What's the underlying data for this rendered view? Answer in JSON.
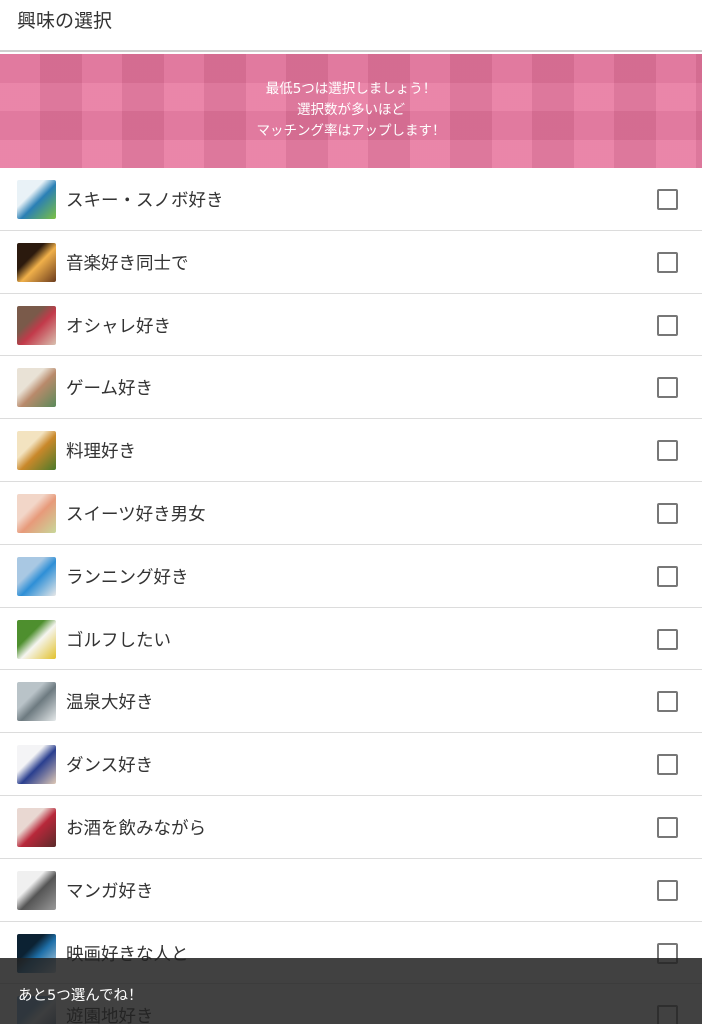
{
  "header": {
    "title": "興味の選択"
  },
  "banner": {
    "line1": "最低5つは選択しましょう！",
    "line2": "選択数が多いほど",
    "line3": "マッチング率はアップします！"
  },
  "interests": [
    {
      "label": "スキー・スノボ好き",
      "icon": "ski-photo-icon",
      "checked": false,
      "colors": [
        "#e9f2f7",
        "#2a7fb5",
        "#7cc142"
      ]
    },
    {
      "label": "音楽好き同士で",
      "icon": "concert-photo-icon",
      "checked": false,
      "colors": [
        "#2b1a0e",
        "#f0b04a",
        "#6b3b1c"
      ]
    },
    {
      "label": "オシャレ好き",
      "icon": "fashion-bag-photo-icon",
      "checked": false,
      "colors": [
        "#7a5a4a",
        "#c23a4a",
        "#d9c1b0"
      ]
    },
    {
      "label": "ゲーム好き",
      "icon": "game-device-photo-icon",
      "checked": false,
      "colors": [
        "#e9e2d6",
        "#b98a6b",
        "#5a8a5a"
      ]
    },
    {
      "label": "料理好き",
      "icon": "cooking-photo-icon",
      "checked": false,
      "colors": [
        "#f3e3c0",
        "#c9882a",
        "#4a7a2a"
      ]
    },
    {
      "label": "スイーツ好き男女",
      "icon": "macaron-photo-icon",
      "checked": false,
      "colors": [
        "#f2d6c8",
        "#e79a7a",
        "#c8d89a"
      ]
    },
    {
      "label": "ランニング好き",
      "icon": "running-photo-icon",
      "checked": false,
      "colors": [
        "#a9c8e3",
        "#2e8fd6",
        "#e8e8e8"
      ]
    },
    {
      "label": "ゴルフしたい",
      "icon": "golf-ball-photo-icon",
      "checked": false,
      "colors": [
        "#4e8f2e",
        "#f5f5f0",
        "#e2c12a"
      ]
    },
    {
      "label": "温泉大好き",
      "icon": "hot-spring-photo-icon",
      "checked": false,
      "colors": [
        "#b9c3c8",
        "#6d7a80",
        "#e5e9ea"
      ]
    },
    {
      "label": "ダンス好き",
      "icon": "dance-photo-icon",
      "checked": false,
      "colors": [
        "#f4f4f6",
        "#2a3f8f",
        "#e0c9b5"
      ]
    },
    {
      "label": "お酒を飲みながら",
      "icon": "wine-photo-icon",
      "checked": false,
      "colors": [
        "#e9d8d2",
        "#b8283a",
        "#5a2a2a"
      ]
    },
    {
      "label": "マンガ好き",
      "icon": "manga-photo-icon",
      "checked": false,
      "colors": [
        "#f0f0f0",
        "#555555",
        "#999999"
      ]
    },
    {
      "label": "映画好きな人と",
      "icon": "movie-screen-photo-icon",
      "checked": false,
      "colors": [
        "#0c2233",
        "#1e6fa8",
        "#c7d9e6"
      ]
    },
    {
      "label": "遊園地好き",
      "icon": "amusement-park-photo-icon",
      "checked": false,
      "colors": [
        "#7fb3e0",
        "#e0e8ef",
        "#4a6a8a"
      ]
    }
  ],
  "toast": {
    "text": "あと5つ選んでね！"
  }
}
